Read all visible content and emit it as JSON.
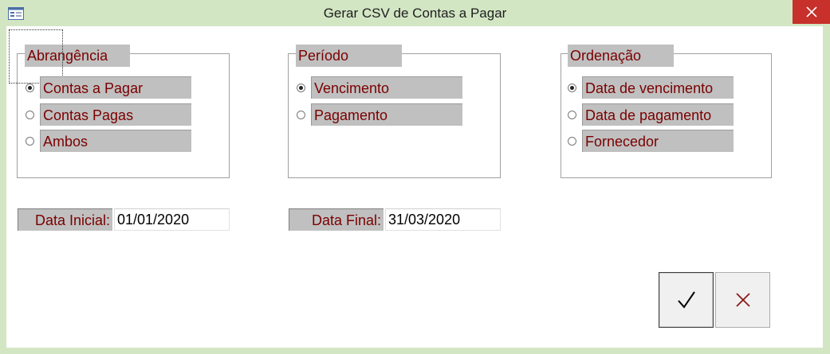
{
  "window": {
    "title": "Gerar CSV de Contas a Pagar",
    "icon": "form-window-icon",
    "accent": "#d3e6c4",
    "close_color": "#c7302b"
  },
  "groups": {
    "abrangencia": {
      "label": "Abrangência",
      "options": [
        {
          "label": "Contas a Pagar",
          "selected": true
        },
        {
          "label": "Contas Pagas",
          "selected": false
        },
        {
          "label": "Ambos",
          "selected": false
        }
      ]
    },
    "periodo": {
      "label": "Período",
      "options": [
        {
          "label": "Vencimento",
          "selected": true
        },
        {
          "label": "Pagamento",
          "selected": false
        }
      ]
    },
    "ordenacao": {
      "label": "Ordenação",
      "options": [
        {
          "label": "Data de vencimento",
          "selected": true
        },
        {
          "label": "Data de pagamento",
          "selected": false
        },
        {
          "label": "Fornecedor",
          "selected": false
        }
      ]
    }
  },
  "fields": {
    "data_inicial": {
      "label": "Data Inicial:",
      "value": "01/01/2020"
    },
    "data_final": {
      "label": "Data Final:",
      "value": "31/03/2020"
    }
  },
  "buttons": {
    "confirm_icon": "checkmark-icon",
    "cancel_icon": "x-icon",
    "cancel_color": "#8b1a1a"
  }
}
